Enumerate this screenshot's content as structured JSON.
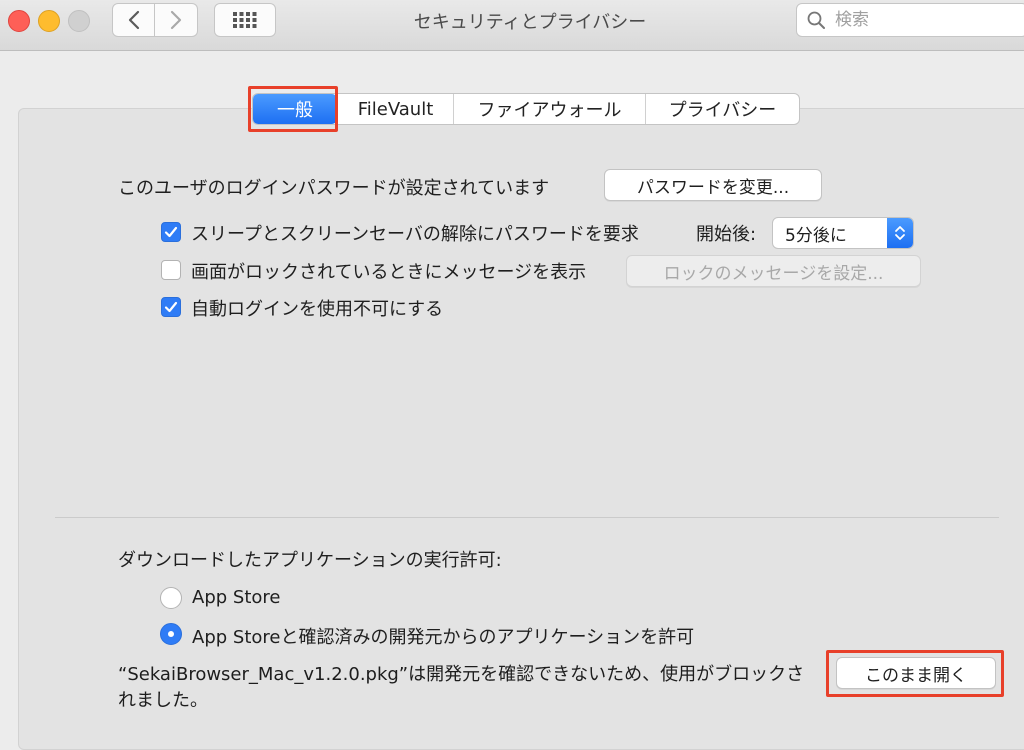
{
  "window": {
    "title": "セキュリティとプライバシー"
  },
  "search": {
    "placeholder": "検索"
  },
  "tabs": [
    {
      "label": "一般",
      "active": true
    },
    {
      "label": "FileVault",
      "active": false
    },
    {
      "label": "ファイアウォール",
      "active": false
    },
    {
      "label": "プライバシー",
      "active": false
    }
  ],
  "login": {
    "password_text": "このユーザのログインパスワードが設定されています",
    "change_password_button": "パスワードを変更...",
    "options": [
      {
        "label": "スリープとスクリーンセーバの解除にパスワードを要求",
        "checked": true
      },
      {
        "label": "画面がロックされているときにメッセージを表示",
        "checked": false
      },
      {
        "label": "自動ログインを使用不可にする",
        "checked": true
      }
    ],
    "delay_label": "開始後:",
    "delay_value": "5分後に",
    "lock_message_button": "ロックのメッセージを設定..."
  },
  "downloads": {
    "heading": "ダウンロードしたアプリケーションの実行許可:",
    "options": [
      {
        "label": "App Store",
        "selected": false
      },
      {
        "label": "App Storeと確認済みの開発元からのアプリケーションを許可",
        "selected": true
      }
    ],
    "blocked_message": "“SekaiBrowser_Mac_v1.2.0.pkg”は開発元を確認できないため、使用がブロックされました。",
    "open_anyway_button": "このまま開く"
  },
  "colors": {
    "accent": "#2f7cf6",
    "highlight": "#e8402a"
  }
}
